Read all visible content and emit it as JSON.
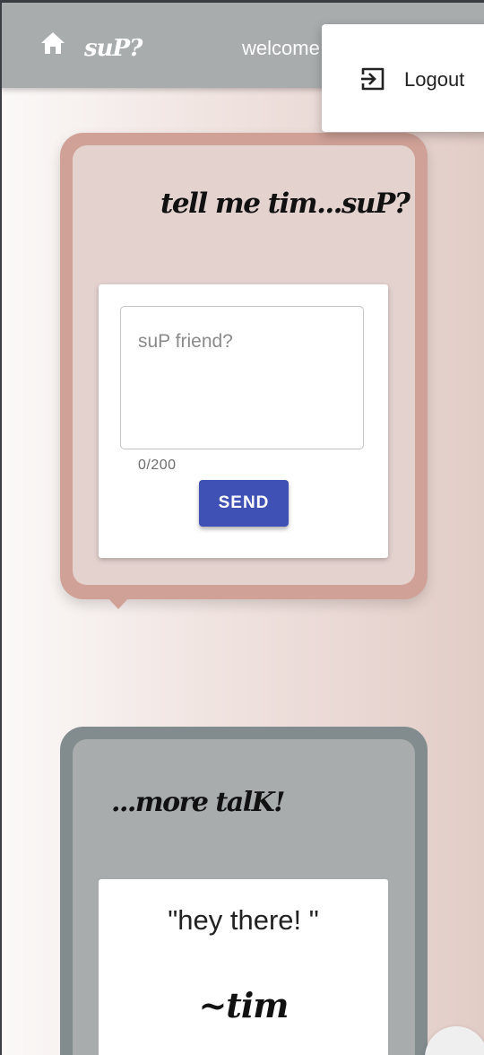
{
  "header": {
    "brand": "suP?",
    "welcome_text": "welcome"
  },
  "user_menu": {
    "logout_label": "Logout"
  },
  "post_card": {
    "title": "tell me tim...suP?",
    "textarea_placeholder": "suP friend?",
    "char_counter": "0/200",
    "send_label": "SEND"
  },
  "talk_card": {
    "title": "...more talK!",
    "quote": "\"hey there! \"",
    "author": "~tim"
  },
  "icons": {
    "home": "home-icon",
    "logout": "logout-icon"
  },
  "colors": {
    "header_bg": "#a8acad",
    "post_card_border": "#cfa197",
    "post_card_bg": "#e4d2cf",
    "talk_card_border": "#828c8e",
    "talk_card_bg": "#a8acad",
    "send_button": "#3f51b5"
  }
}
